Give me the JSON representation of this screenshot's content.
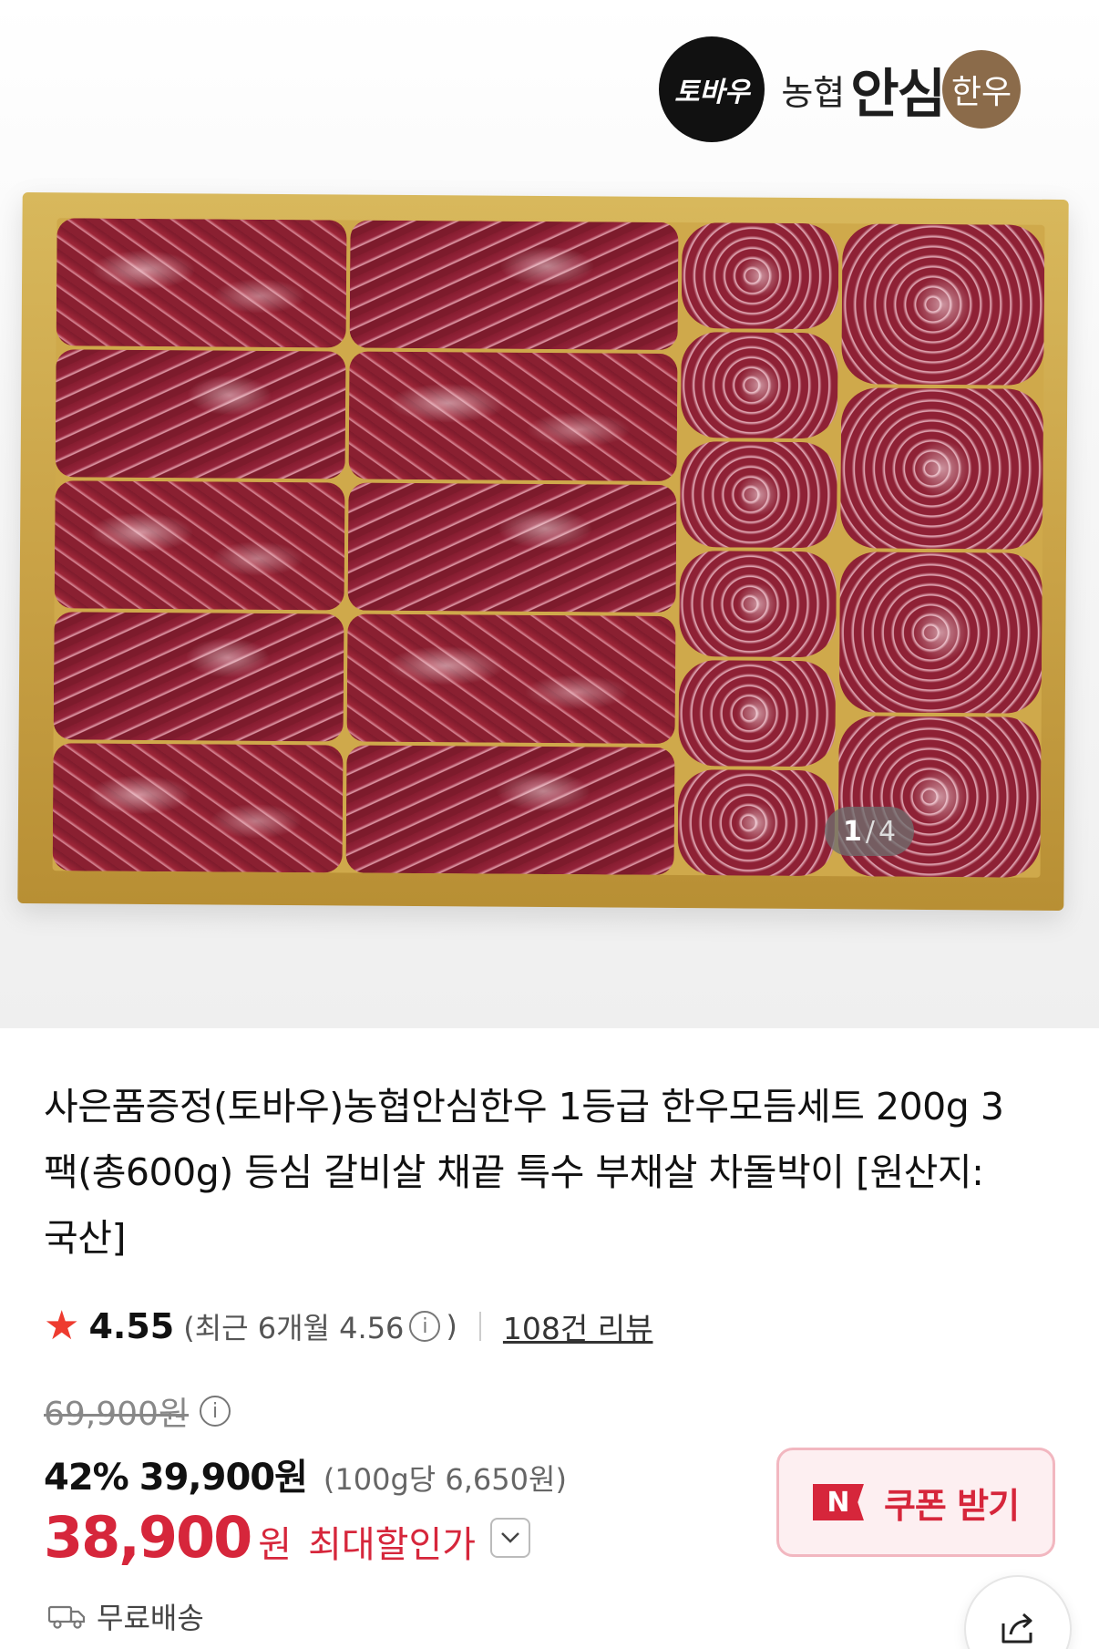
{
  "hero": {
    "logo": {
      "badge_text": "토바우",
      "brand_prefix": "농협",
      "brand_main": "안심",
      "brand_suffix": "한우"
    },
    "pager": {
      "current": "1",
      "separator": "/",
      "total": "4"
    }
  },
  "product": {
    "title": "사은품증정(토바우)농협안심한우 1등급 한우모듬세트 200g 3팩(총600g) 등심 갈비살 채끝 특수 부채살 차돌박이 [원산지:국산]",
    "rating": "4.55",
    "recent_rating": "(최근 6개월 4.56",
    "recent_close": ")",
    "review_link": "108건 리뷰"
  },
  "price": {
    "original": "69,900원",
    "discount_rate": "42%",
    "discount_price": "39,900원",
    "unit_price": "(100g당 6,650원)",
    "final_amount": "38,900",
    "final_currency": "원",
    "max_discount_label": "최대할인가"
  },
  "coupon": {
    "label": "쿠폰 받기",
    "badge": "N"
  },
  "shipping": {
    "label": "무료배송"
  },
  "colors": {
    "accent": "#d6263b",
    "star": "#ee3b2f",
    "coupon_bg": "#fdeff1"
  }
}
